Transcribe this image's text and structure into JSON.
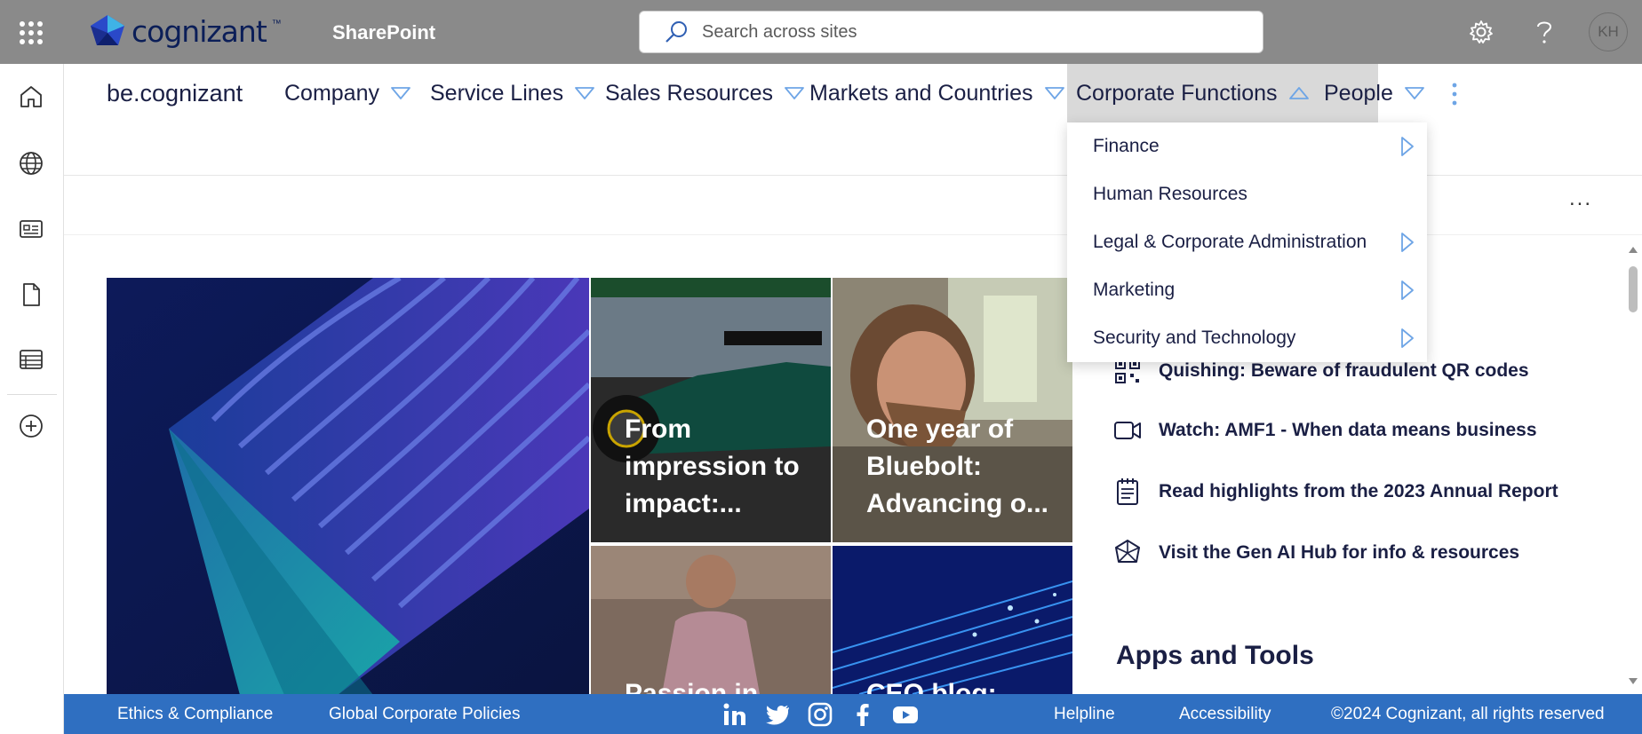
{
  "suitebar": {
    "logo_text": "cognizant",
    "logo_tm": "™",
    "app_name": "SharePoint",
    "search_placeholder": "Search across sites",
    "avatar_initials": "KH"
  },
  "hubnav": {
    "site_title": "be.cognizant",
    "items": [
      {
        "label": "Company"
      },
      {
        "label": "Service Lines"
      },
      {
        "label": "Sales Resources"
      },
      {
        "label": "Markets and Countries"
      },
      {
        "label": "Corporate Functions",
        "expanded": true
      },
      {
        "label": "People"
      }
    ]
  },
  "dropdown": {
    "items": [
      {
        "label": "Finance",
        "has_submenu": true
      },
      {
        "label": "Human Resources",
        "has_submenu": false
      },
      {
        "label": "Legal & Corporate Administration",
        "has_submenu": true
      },
      {
        "label": "Marketing",
        "has_submenu": true
      },
      {
        "label": "Security and Technology",
        "has_submenu": true
      }
    ]
  },
  "cmdbar": {
    "more": "..."
  },
  "tiles": [
    {
      "title": "From impression to impact:..."
    },
    {
      "title": "One year of Bluebolt: Advancing o..."
    },
    {
      "title": "Passion in..."
    },
    {
      "title": "CEO blog:..."
    }
  ],
  "quicklinks": [
    {
      "label": "Quishing: Beware of fraudulent QR codes",
      "icon": "qr-code-icon"
    },
    {
      "label": "Watch: AMF1 - When data means business",
      "icon": "video-camera-icon"
    },
    {
      "label": "Read highlights from the 2023 Annual Report",
      "icon": "notepad-icon"
    },
    {
      "label": "Visit the Gen AI Hub for info & resources",
      "icon": "ai-network-icon"
    }
  ],
  "apps_heading": "Apps and Tools",
  "footer": {
    "ethics": "Ethics & Compliance",
    "policies": "Global Corporate Policies",
    "helpline": "Helpline",
    "accessibility": "Accessibility",
    "copyright": "©2024 Cognizant, all rights reserved",
    "social": [
      "linkedin-icon",
      "twitter-icon",
      "instagram-icon",
      "facebook-icon",
      "youtube-icon"
    ]
  },
  "colors": {
    "suitebar": "#8a8a8a",
    "footer": "#2f6fc1",
    "nav_text": "#1a1f44",
    "accent_triangle": "#6ea5e6"
  }
}
